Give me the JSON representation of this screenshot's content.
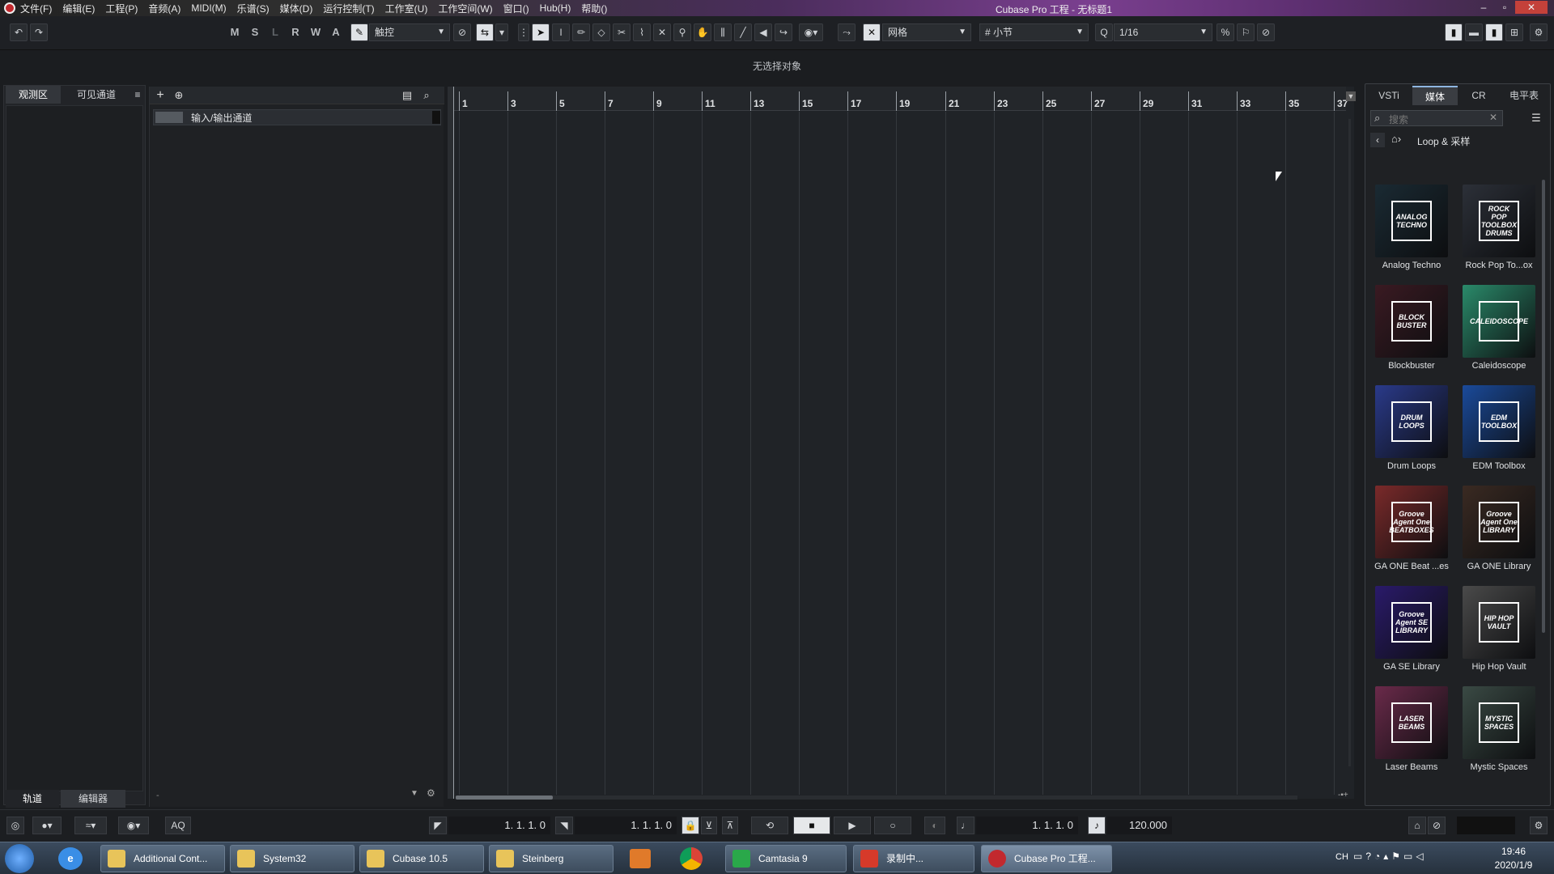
{
  "window": {
    "title": "Cubase Pro 工程 - 无标题1"
  },
  "menu": [
    "文件(F)",
    "编辑(E)",
    "工程(P)",
    "音频(A)",
    "MIDI(M)",
    "乐谱(S)",
    "媒体(D)",
    "运行控制(T)",
    "工作室(U)",
    "工作空间(W)",
    "窗口()",
    "Hub(H)",
    "帮助()"
  ],
  "toolbar": {
    "msl": [
      "M",
      "S",
      "L",
      "R",
      "W",
      "A"
    ],
    "automation_mode": "触控",
    "snap_type": "网格",
    "grid_type": "小节",
    "quantize": "1/16"
  },
  "info_line": "无选择对象",
  "left_zone": {
    "tabs": [
      "观测区",
      "可见通道"
    ],
    "bottom_tabs": [
      "轨道",
      "编辑器"
    ]
  },
  "track_panel": {
    "tracks": [
      "输入/输出通道"
    ]
  },
  "ruler": [
    "1",
    "3",
    "5",
    "7",
    "9",
    "11",
    "13",
    "15",
    "17",
    "19",
    "21",
    "23",
    "25",
    "27",
    "29",
    "31",
    "33",
    "35",
    "37"
  ],
  "right_zone": {
    "tabs": [
      "VSTi",
      "媒体",
      "CR",
      "电平表"
    ],
    "search_placeholder": "搜索",
    "breadcrumb": "Loop & 采样",
    "items": [
      {
        "label": "Analog Techno",
        "art": "ANALOG TECHNO",
        "color": "#1a2a33"
      },
      {
        "label": "Rock Pop To...ox",
        "art": "ROCK POP TOOLBOX DRUMS",
        "color": "#2c3038"
      },
      {
        "label": "Blockbuster",
        "art": "BLOCK BUSTER",
        "color": "#3a1a22"
      },
      {
        "label": "Caleidoscope",
        "art": "CALEIDOSCOPE",
        "color": "#2a8a6a"
      },
      {
        "label": "Drum Loops",
        "art": "DRUM LOOPS",
        "color": "#2a3a8a"
      },
      {
        "label": "EDM Toolbox",
        "art": "EDM TOOLBOX",
        "color": "#1a4a9a"
      },
      {
        "label": "GA ONE Beat ...es",
        "art": "Groove Agent One BEATBOXES",
        "color": "#7a2a2a"
      },
      {
        "label": "GA ONE Library",
        "art": "Groove Agent One LIBRARY",
        "color": "#3a2a22"
      },
      {
        "label": "GA SE Library",
        "art": "Groove Agent SE LIBRARY",
        "color": "#2a1a6a"
      },
      {
        "label": "Hip Hop Vault",
        "art": "HIP HOP VAULT",
        "color": "#4a4a4a"
      },
      {
        "label": "Laser Beams",
        "art": "LASER BEAMS",
        "color": "#6a2a4a"
      },
      {
        "label": "Mystic Spaces",
        "art": "MYSTIC SPACES",
        "color": "#3a4a44"
      }
    ]
  },
  "transport": {
    "left_locator": "1. 1. 1.   0",
    "right_locator": "1. 1. 1.   0",
    "position": "1. 1. 1.   0",
    "tempo": "120.000",
    "aq": "AQ"
  },
  "taskbar": {
    "items": [
      "Additional Cont...",
      "System32",
      "Cubase 10.5",
      "Steinberg",
      "Camtasia 9",
      "录制中...",
      "Cubase Pro 工程..."
    ],
    "time": "19:46",
    "date": "2020/1/9",
    "lang": "CH"
  }
}
